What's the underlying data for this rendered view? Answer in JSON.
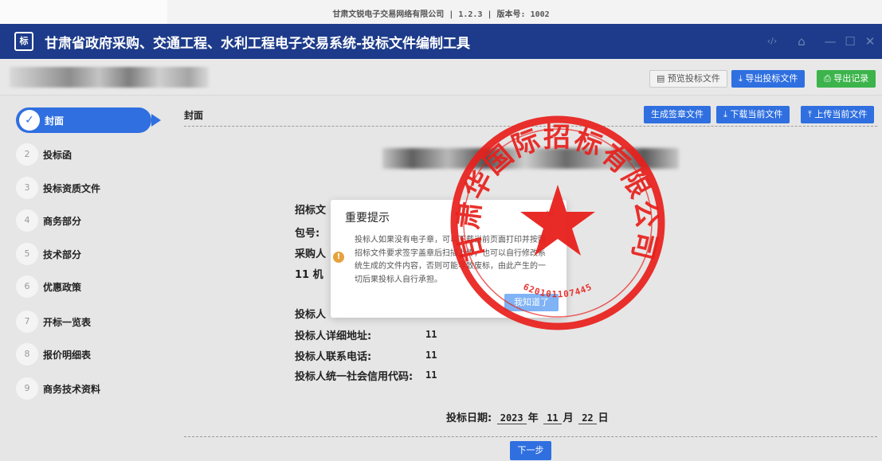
{
  "topbar": {
    "version_line": "甘肃文锐电子交易网络有限公司 | 1.2.3 | 版本号: 1002"
  },
  "app": {
    "logo_text": "标",
    "title": "甘肃省政府采购、交通工程、水利工程电子交易系统-投标文件编制工具"
  },
  "window_controls": {
    "code": "‹/›",
    "home": "⌂",
    "minimize": "—",
    "maximize": "☐",
    "close": "✕"
  },
  "toolbar": {
    "preview": "预览投标文件",
    "export": "导出投标文件",
    "export_log": "导出记录"
  },
  "sidebar": {
    "active": {
      "label": "封面"
    },
    "items": [
      {
        "num": "2",
        "label": "投标函"
      },
      {
        "num": "3",
        "label": "投标资质文件"
      },
      {
        "num": "4",
        "label": "商务部分"
      },
      {
        "num": "5",
        "label": "技术部分"
      },
      {
        "num": "6",
        "label": "优惠政策"
      },
      {
        "num": "7",
        "label": "开标一览表"
      },
      {
        "num": "8",
        "label": "报价明细表"
      },
      {
        "num": "9",
        "label": "商务技术资料"
      }
    ]
  },
  "content": {
    "section_title": "封面",
    "buttons": {
      "gen_sign": "生成签章文件",
      "download": "下载当前文件",
      "upload": "上传当前文件"
    },
    "fields_partial": [
      "招标文",
      "包号:",
      "采购人",
      "11 机"
    ],
    "bidder_label": "投标人",
    "fields": [
      {
        "label": "投标人详细地址:",
        "value": "11"
      },
      {
        "label": "投标人联系电话:",
        "value": "11"
      },
      {
        "label": "投标人统一社会信用代码:",
        "value": "11"
      }
    ],
    "date": {
      "label": "投标日期:",
      "year": "2023",
      "year_unit": "年",
      "month": "11",
      "month_unit": "月",
      "day": "22",
      "day_unit": "日"
    },
    "next": "下一步"
  },
  "dialog": {
    "title": "重要提示",
    "close": "×",
    "warn_icon": "!",
    "message": "投标人如果没有电子章，可以下载当前页面打印并按照招标文件要求签字盖章后扫描上传，也可以自行修改系统生成的文件内容，否则可能导致废标，由此产生的一切后果投标人自行承担。",
    "ok": "我知道了"
  },
  "seal": {
    "text": "甘肃华国际招标有限公司",
    "code": "620101107445",
    "color": "#e8201c"
  }
}
